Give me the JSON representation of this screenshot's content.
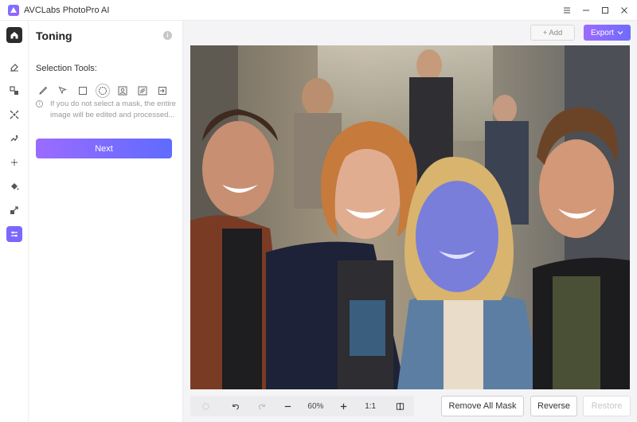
{
  "window": {
    "title": "AVCLabs PhotoPro AI",
    "controls": [
      "menu-icon",
      "minimize-icon",
      "maximize-icon",
      "close-icon"
    ]
  },
  "rail": {
    "items": [
      {
        "name": "home-icon",
        "active": false
      },
      {
        "name": "eraser-icon",
        "active": false
      },
      {
        "name": "replace-icon",
        "active": false
      },
      {
        "name": "expand-icon",
        "active": false
      },
      {
        "name": "colorize-icon",
        "active": false
      },
      {
        "name": "fan-icon",
        "active": false
      },
      {
        "name": "paint-bucket-icon",
        "active": false
      },
      {
        "name": "upscale-icon",
        "active": false
      },
      {
        "name": "toning-icon",
        "active": true
      }
    ]
  },
  "panel": {
    "title": "Toning",
    "selection_label": "Selection Tools:",
    "tools": [
      "brush-icon",
      "lasso-icon",
      "rectangle-icon",
      "ellipse-icon",
      "portrait-icon",
      "auto-select-icon",
      "import-mask-icon"
    ],
    "selected_tool": "ellipse-icon",
    "hint": "If you do not select a mask, the entire image will be edited and processed...",
    "next_label": "Next"
  },
  "toolbar": {
    "add_label": "+ Add",
    "export_label": "Export"
  },
  "zoom": {
    "value": "60%",
    "one_to_one": "1:1"
  },
  "actions": {
    "remove_all_mask": "Remove All Mask",
    "reverse": "Reverse",
    "restore": "Restore"
  },
  "colors": {
    "accent": "#7b67ff",
    "mask": "#5a6cff"
  }
}
